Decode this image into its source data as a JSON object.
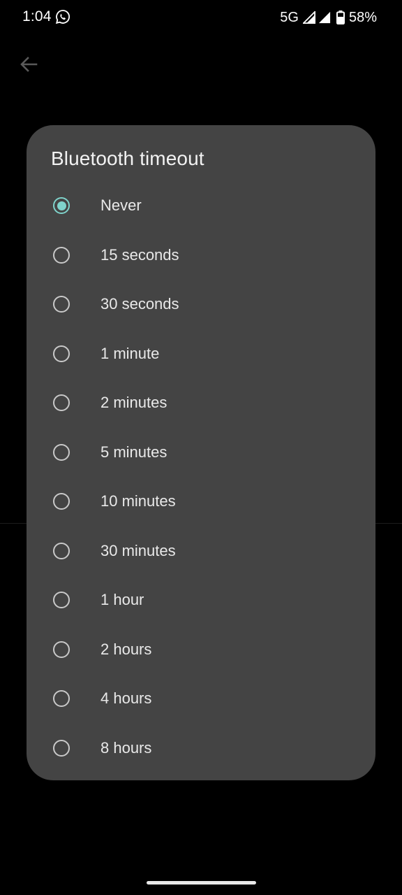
{
  "status_bar": {
    "time": "1:04",
    "notification_icon": "whatsapp-icon",
    "network": "5G",
    "battery": "58%"
  },
  "background": {
    "back_icon": "arrow-back-icon"
  },
  "dialog": {
    "title": "Bluetooth timeout",
    "accent_color": "#7fd3cb",
    "options": [
      {
        "label": "Never",
        "selected": true
      },
      {
        "label": "15 seconds",
        "selected": false
      },
      {
        "label": "30 seconds",
        "selected": false
      },
      {
        "label": "1 minute",
        "selected": false
      },
      {
        "label": "2 minutes",
        "selected": false
      },
      {
        "label": "5 minutes",
        "selected": false
      },
      {
        "label": "10 minutes",
        "selected": false
      },
      {
        "label": "30 minutes",
        "selected": false
      },
      {
        "label": "1 hour",
        "selected": false
      },
      {
        "label": "2 hours",
        "selected": false
      },
      {
        "label": "4 hours",
        "selected": false
      },
      {
        "label": "8 hours",
        "selected": false
      }
    ]
  }
}
